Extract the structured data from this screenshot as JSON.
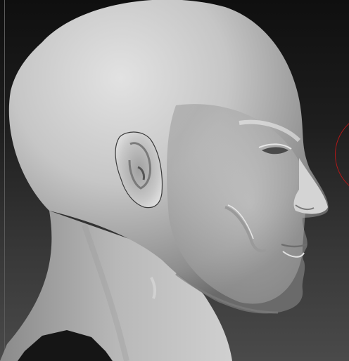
{
  "canvas": {
    "background_top": "#0f0f0f",
    "background_bottom": "#4a4a4a",
    "model_base_color": "#b4b4b4",
    "brush_cursor_color": "#b01818"
  },
  "model": {
    "subject": "bald-male-head-profile-facing-right",
    "material": "matcap-gray"
  }
}
